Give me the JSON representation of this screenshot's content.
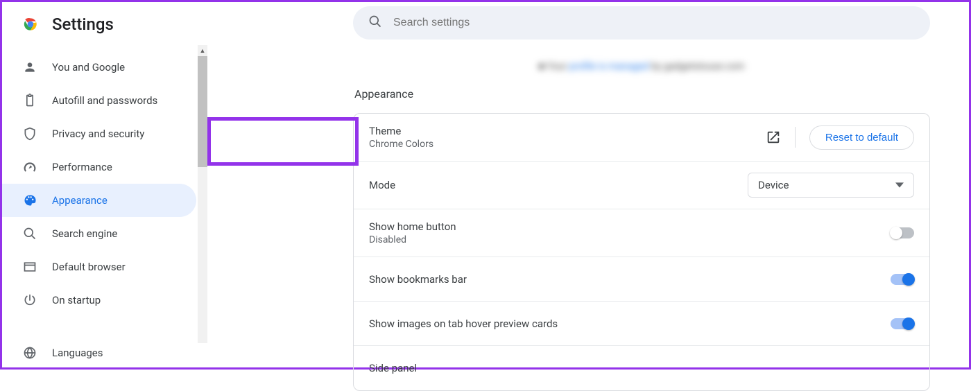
{
  "header": {
    "title": "Settings"
  },
  "search": {
    "placeholder": "Search settings"
  },
  "sidebar": {
    "items": [
      {
        "label": "You and Google"
      },
      {
        "label": "Autofill and passwords"
      },
      {
        "label": "Privacy and security"
      },
      {
        "label": "Performance"
      },
      {
        "label": "Appearance"
      },
      {
        "label": "Search engine"
      },
      {
        "label": "Default browser"
      },
      {
        "label": "On startup"
      },
      {
        "label": "Languages"
      }
    ]
  },
  "section": {
    "title": "Appearance"
  },
  "theme": {
    "title": "Theme",
    "value": "Chrome Colors",
    "reset_label": "Reset to default"
  },
  "mode": {
    "title": "Mode",
    "selected": "Device"
  },
  "home_button": {
    "title": "Show home button",
    "value": "Disabled",
    "enabled": false
  },
  "bookmarks_bar": {
    "title": "Show bookmarks bar",
    "enabled": true
  },
  "tab_hover": {
    "title": "Show images on tab hover preview cards",
    "enabled": true
  },
  "side_panel": {
    "title": "Side panel"
  }
}
